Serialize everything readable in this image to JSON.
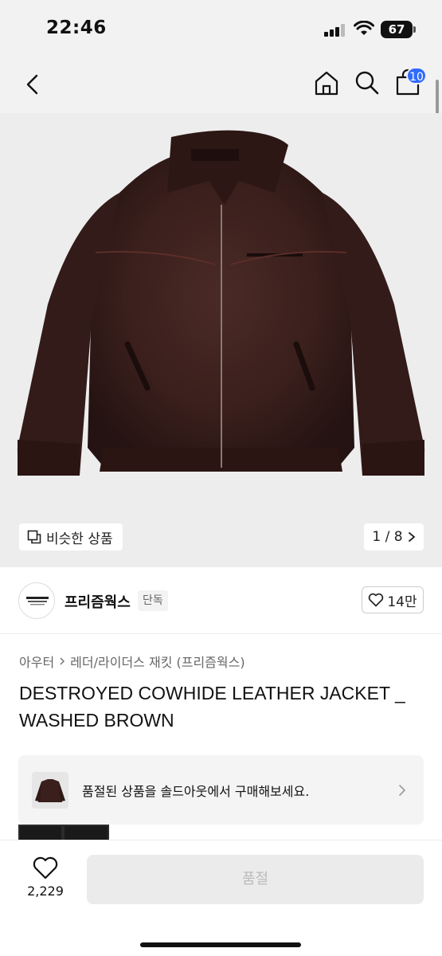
{
  "status_bar": {
    "time": "22:46",
    "battery": "67"
  },
  "nav": {
    "cart_count": "10"
  },
  "gallery": {
    "similar_label": "비슷한 상품",
    "page": "1 / 8"
  },
  "brand": {
    "name": "프리즘웍스",
    "tag": "단독",
    "likes": "14만"
  },
  "breadcrumb": {
    "category": "아우터",
    "subcategory": "레더/라이더스 재킷 (프리즘웍스)"
  },
  "product": {
    "title": "DESTROYED COWHIDE LEATHER JACKET _ WASHED BROWN"
  },
  "soldout_banner": {
    "text": "품절된 상품을 솔드아웃에서 구매해보세요."
  },
  "bottom": {
    "wish_count": "2,229",
    "buy_label": "품절"
  },
  "colors": {
    "accent": "#2f6bff",
    "leather": "#3a1f1c"
  },
  "icons": [
    "back-icon",
    "home-icon",
    "search-icon",
    "cart-icon",
    "heart-icon",
    "copy-icon",
    "chevron-right-icon"
  ]
}
